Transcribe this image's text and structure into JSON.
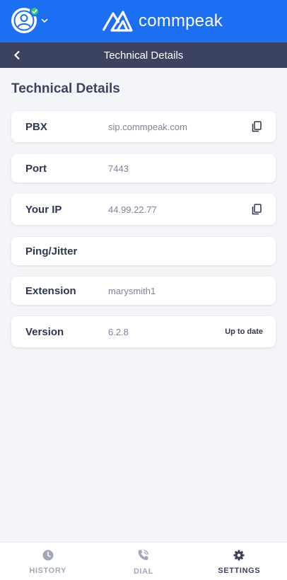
{
  "header": {
    "brand_name": "commpeak",
    "brand_color": "#1c6ef2",
    "status": "online"
  },
  "subheader": {
    "title": "Technical Details",
    "back_icon": "chevron-left-icon"
  },
  "page": {
    "title": "Technical Details"
  },
  "details": {
    "pbx": {
      "label": "PBX",
      "value": "sip.commpeak.com",
      "action_icon": "copy-icon"
    },
    "port": {
      "label": "Port",
      "value": "7443"
    },
    "ip": {
      "label": "Your IP",
      "value": "44.99.22.77",
      "action_icon": "copy-icon"
    },
    "ping": {
      "label": "Ping/Jitter",
      "value": ""
    },
    "extension": {
      "label": "Extension",
      "value": "marysmith1"
    },
    "version": {
      "label": "Version",
      "value": "6.2.8",
      "status": "Up to date"
    }
  },
  "nav": {
    "history": {
      "label": "HISTORY",
      "icon": "clock-icon"
    },
    "dial": {
      "label": "DIAL",
      "icon": "phone-icon"
    },
    "settings": {
      "label": "SETTINGS",
      "icon": "gear-icon",
      "active": true
    }
  },
  "colors": {
    "header_dark": "#3b4361",
    "status_green": "#2fcf6f",
    "background": "#f4f5f9"
  }
}
